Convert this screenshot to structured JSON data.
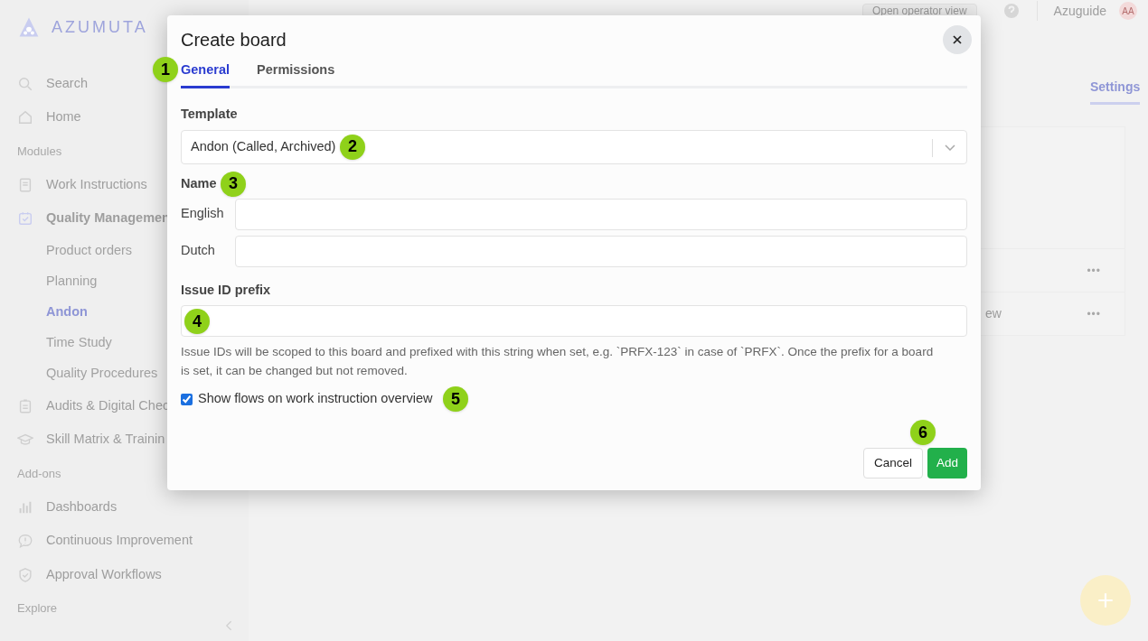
{
  "brand": "AZUMUTA",
  "topbar": {
    "operator_button": "Open operator view",
    "user": "Azuguide",
    "avatar": "AA"
  },
  "sidebar": {
    "items": [
      {
        "kind": "item",
        "label": "Search",
        "selected": false
      },
      {
        "kind": "item",
        "label": "Home",
        "selected": false
      },
      {
        "kind": "section",
        "label": "Modules"
      },
      {
        "kind": "item",
        "label": "Work Instructions",
        "selected": false
      },
      {
        "kind": "item",
        "label": "Quality Managemen",
        "selected": false
      },
      {
        "kind": "subitem",
        "label": "Product orders",
        "selected": false
      },
      {
        "kind": "subitem",
        "label": "Planning",
        "selected": false
      },
      {
        "kind": "subitem",
        "label": "Andon",
        "selected": true
      },
      {
        "kind": "subitem",
        "label": "Time Study",
        "selected": false
      },
      {
        "kind": "subitem",
        "label": "Quality Procedures",
        "selected": false
      },
      {
        "kind": "item",
        "label": "Audits & Digital Chec",
        "selected": false
      },
      {
        "kind": "item",
        "label": "Skill Matrix & Trainin",
        "selected": false
      },
      {
        "kind": "section",
        "label": "Add-ons"
      },
      {
        "kind": "item",
        "label": "Dashboards",
        "selected": false
      },
      {
        "kind": "item",
        "label": "Continuous Improvement",
        "selected": false
      },
      {
        "kind": "item",
        "label": "Approval Workflows",
        "selected": false
      },
      {
        "kind": "section",
        "label": "Explore"
      }
    ]
  },
  "page": {
    "tab": {
      "label": "Settings",
      "selected": true
    },
    "rows": [
      {
        "menu": "•••"
      },
      {
        "text": "ew",
        "menu": "•••"
      }
    ]
  },
  "modal": {
    "title": "Create board",
    "tabs": [
      {
        "label": "General",
        "selected": true
      },
      {
        "label": "Permissions",
        "selected": false
      }
    ],
    "template_label": "Template",
    "template_value": "Andon (Called, Archived)",
    "name_label": "Name",
    "languages": [
      "English",
      "Dutch"
    ],
    "prefix_label": "Issue ID prefix",
    "prefix_help": "Issue IDs will be scoped to this board and prefixed with this string when set, e.g. `PRFX-123` in case of `PRFX`. Once the prefix for a board is set, it can be changed but not removed.",
    "checkbox": {
      "label": "Show flows on work instruction overview",
      "checked": true
    },
    "buttons": {
      "cancel": "Cancel",
      "add": "Add"
    }
  },
  "markers": [
    "1",
    "2",
    "3",
    "4",
    "5",
    "6"
  ]
}
